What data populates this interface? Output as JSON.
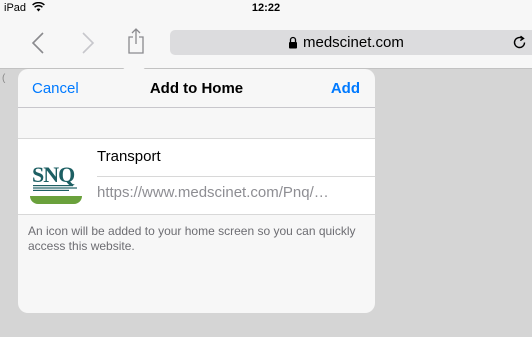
{
  "status_bar": {
    "device": "iPad",
    "time": "12:22",
    "wifi_icon": "wifi-icon"
  },
  "browser": {
    "url": "medscinet.com",
    "icons": {
      "back": "chevron-left-icon",
      "forward": "chevron-right-icon",
      "share": "share-icon",
      "lock": "lock-icon",
      "reload": "reload-icon"
    },
    "page_stub_letter": "("
  },
  "add_to_home": {
    "cancel_label": "Cancel",
    "title": "Add to Home",
    "add_label": "Add",
    "icon_text": "SNQ",
    "name_value": "Transport",
    "url_value": "https://www.medscinet.com/Pnq/…",
    "note": "An icon will be added to your home screen so you can quickly access this website."
  },
  "colors": {
    "accent": "#007aff",
    "brand_teal": "#1d5f63",
    "brand_green": "#6aa13c"
  }
}
